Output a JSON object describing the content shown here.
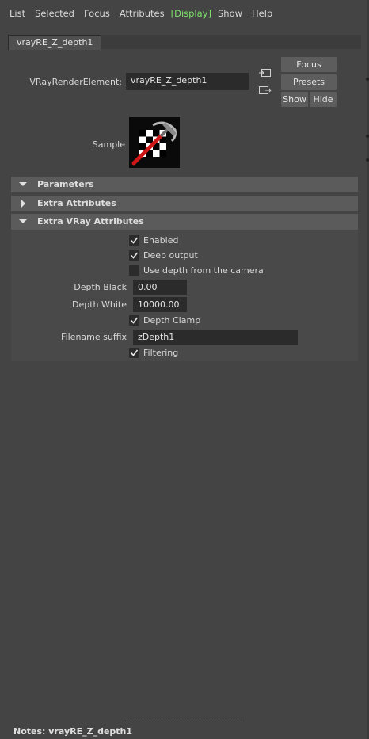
{
  "menubar": {
    "items": [
      "List",
      "Selected",
      "Focus",
      "Attributes",
      "Display",
      "Show",
      "Help"
    ],
    "active_open": "[",
    "active_close": "]"
  },
  "tab": {
    "label": "vrayRE_Z_depth1"
  },
  "node": {
    "type_label": "VRayRenderElement:",
    "name_value": "vrayRE_Z_depth1"
  },
  "buttons": {
    "focus": "Focus",
    "presets": "Presets",
    "show": "Show",
    "hide": "Hide"
  },
  "sample": {
    "label": "Sample"
  },
  "sections": {
    "parameters": "Parameters",
    "extra_attributes": "Extra Attributes",
    "extra_vray": "Extra VRay Attributes"
  },
  "attrs": {
    "enabled": {
      "label": "Enabled",
      "checked": true
    },
    "deep_output": {
      "label": "Deep output",
      "checked": true
    },
    "use_depth_camera": {
      "label": "Use depth from the camera",
      "checked": false
    },
    "depth_black": {
      "label": "Depth Black",
      "value": "0.00"
    },
    "depth_white": {
      "label": "Depth White",
      "value": "10000.00"
    },
    "depth_clamp": {
      "label": "Depth Clamp",
      "checked": true
    },
    "filename_suffix": {
      "label": "Filename suffix",
      "value": "zDepth1"
    },
    "filtering": {
      "label": "Filtering",
      "checked": true
    }
  },
  "notes": {
    "label": "Notes:  vrayRE_Z_depth1"
  },
  "colors": {
    "active_menu": "#7ee06b",
    "background": "#444444",
    "section": "#5b5b5b",
    "field": "#2b2b2b"
  }
}
